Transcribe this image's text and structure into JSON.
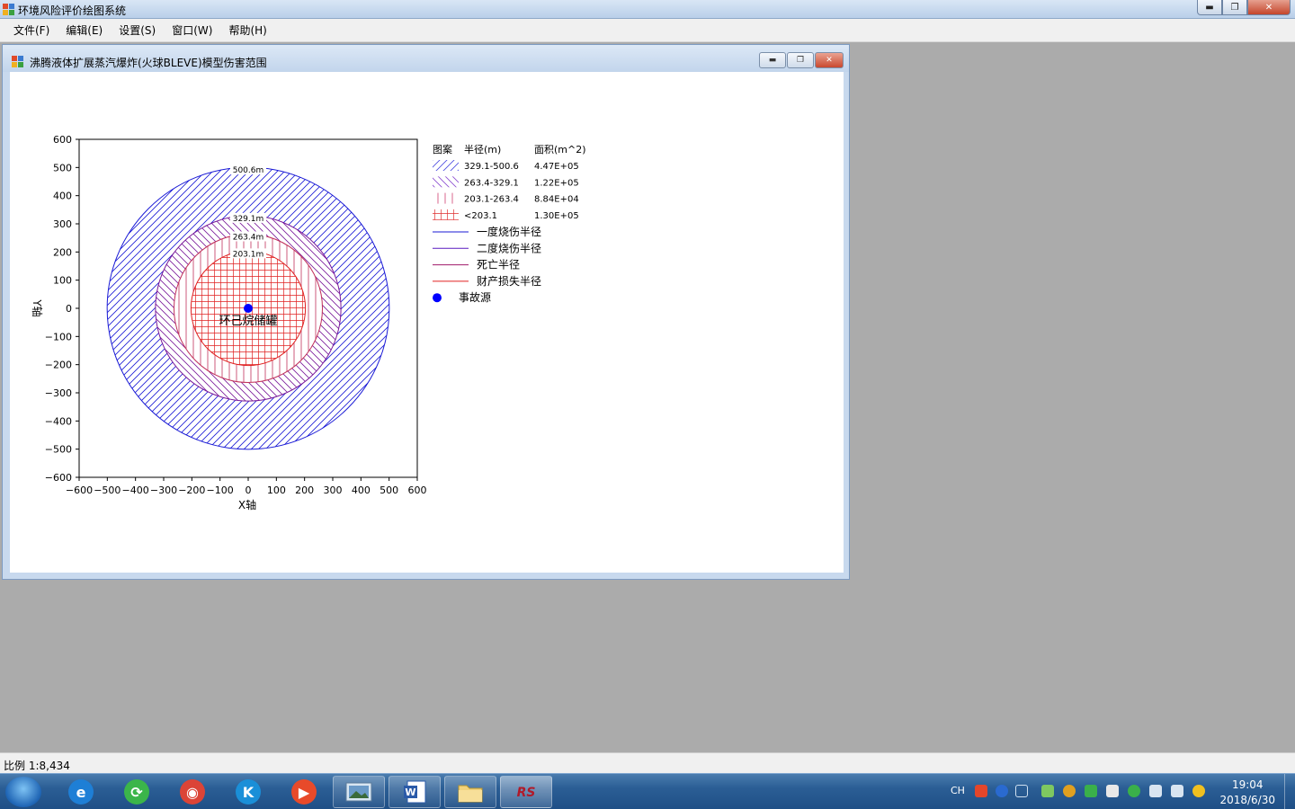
{
  "window": {
    "title": "环境风险评价绘图系统"
  },
  "menu": [
    {
      "label": "文件(F)"
    },
    {
      "label": "编辑(E)"
    },
    {
      "label": "设置(S)"
    },
    {
      "label": "窗口(W)"
    },
    {
      "label": "帮助(H)"
    }
  ],
  "child_window": {
    "title": "沸腾液体扩展蒸汽爆炸(火球BLEVE)模型伤害范围"
  },
  "chart_data": {
    "type": "scatter",
    "xlabel": "X轴",
    "ylabel": "Y轴",
    "xlim": [
      -600,
      600
    ],
    "ylim": [
      -600,
      600
    ],
    "xticks": [
      -600,
      -500,
      -400,
      -300,
      -200,
      -100,
      0,
      100,
      200,
      300,
      400,
      500,
      600
    ],
    "yticks": [
      600,
      500,
      400,
      300,
      200,
      100,
      0,
      -100,
      -200,
      -300,
      -400,
      -500,
      -600
    ],
    "source": {
      "x": 0,
      "y": 0,
      "label": "环己烷储罐"
    },
    "circles": [
      {
        "radius": 500.6,
        "label": "500.6m",
        "color": "#1a1ad6",
        "hatch": "diag-right"
      },
      {
        "radius": 329.1,
        "label": "329.1m",
        "color": "#7a1a9a",
        "hatch": "diag-left"
      },
      {
        "radius": 263.4,
        "label": "263.4m",
        "color": "#c0305a",
        "hatch": "vertical"
      },
      {
        "radius": 203.1,
        "label": "203.1m",
        "color": "#e02020",
        "hatch": "grid"
      }
    ],
    "legend": {
      "headers": [
        "图案",
        "半径(m)",
        "面积(m^2)"
      ],
      "rows": [
        {
          "range": "329.1-500.6",
          "area": "4.47E+05",
          "color": "#4a4ae0",
          "hatch": "diag-right"
        },
        {
          "range": "263.4-329.1",
          "area": "1.22E+05",
          "color": "#8a4ad0",
          "hatch": "diag-left"
        },
        {
          "range": "203.1-263.4",
          "area": "8.84E+04",
          "color": "#d04070",
          "hatch": "vertical"
        },
        {
          "range": "<203.1",
          "area": "1.30E+05",
          "color": "#e03030",
          "hatch": "grid"
        }
      ],
      "lines": [
        {
          "label": "一度烧伤半径",
          "color": "#1a1ad6"
        },
        {
          "label": "二度烧伤半径",
          "color": "#5a1ac0"
        },
        {
          "label": "死亡半径",
          "color": "#a01a6a"
        },
        {
          "label": "财产损失半径",
          "color": "#e02020"
        }
      ],
      "marker": {
        "label": "事故源",
        "color": "#0000ff"
      }
    }
  },
  "status": {
    "scale": "比例 1:8,434"
  },
  "taskbar": {
    "tray_lang": "CH",
    "time": "19:04",
    "date": "2018/6/30",
    "pinned": [
      {
        "name": "ie",
        "color": "#1e7fd6",
        "glyph": "e"
      },
      {
        "name": "360",
        "color": "#3bb54a",
        "glyph": "⟳"
      },
      {
        "name": "chrome",
        "color": "#db4437",
        "glyph": "◉"
      },
      {
        "name": "k",
        "color": "#1a8fd8",
        "glyph": "K"
      },
      {
        "name": "player",
        "color": "#e84a2a",
        "glyph": "▶"
      }
    ]
  }
}
